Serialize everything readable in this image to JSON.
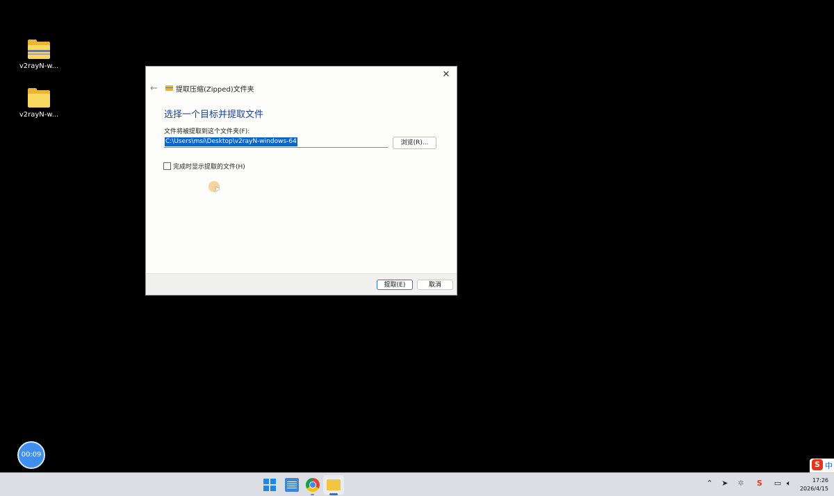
{
  "desktop": {
    "icons": [
      {
        "label": "v2rayN-w...",
        "type": "zip-folder-icon"
      },
      {
        "label": "v2rayN-w...",
        "type": "folder-icon"
      }
    ]
  },
  "dialog": {
    "breadcrumb": "提取压缩(Zipped)文件夹",
    "heading": "选择一个目标并提取文件",
    "field_label": "文件将被提取到这个文件夹(F):",
    "path_value": "C:\\Users\\msi\\Desktop\\v2rayN-windows-64",
    "browse_label": "浏览(R)...",
    "show_files_label": "完成时显示提取的文件(H)",
    "show_files_checked": false,
    "extract_label": "提取(E)",
    "cancel_label": "取消",
    "close_glyph": "✕",
    "back_glyph": "←"
  },
  "overlay": {
    "timer": "00:09",
    "ime_label": "中"
  },
  "taskbar": {
    "apps": [
      "start-icon",
      "notepad-icon",
      "chrome-icon",
      "file-explorer-icon"
    ],
    "active_app": "file-explorer-icon",
    "tray_icons": [
      "chevron-up-icon",
      "telegram-icon",
      "network-app-icon",
      "sogou-ime-icon",
      "wifi-icon",
      "volume-icon"
    ],
    "time": "17:26",
    "date": "2026/4/15"
  },
  "colors": {
    "accent": "#1c3f94",
    "selection": "#0a64c9",
    "timer": "#3f8ef0"
  }
}
